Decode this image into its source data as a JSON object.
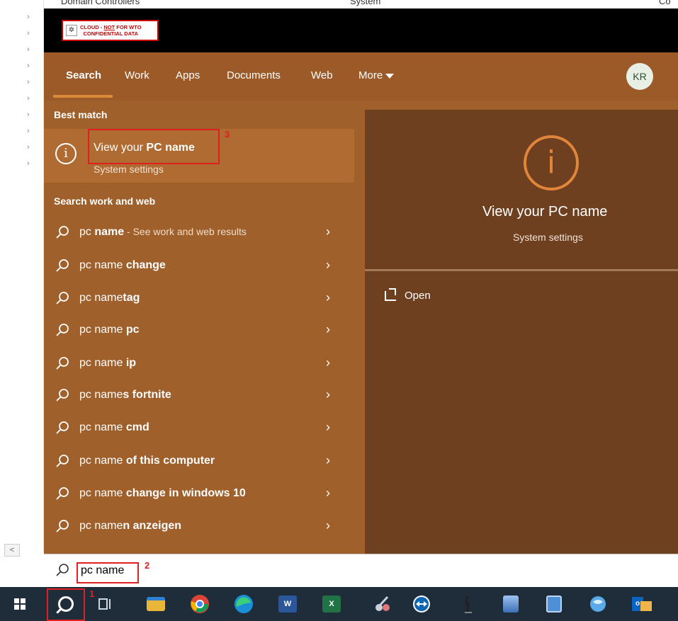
{
  "background": {
    "top_items": [
      "Domain Controllers",
      "System",
      "Co"
    ],
    "scroll_left_label": "<"
  },
  "badge": {
    "line1_prefix": "CLOUD - ",
    "line1_emph": "NOT",
    "line1_suffix": " FOR WTO",
    "line2": "CONFIDENTIAL DATA"
  },
  "tabs": [
    {
      "label": "Search",
      "active": true
    },
    {
      "label": "Work"
    },
    {
      "label": "Apps"
    },
    {
      "label": "Documents"
    },
    {
      "label": "Web"
    },
    {
      "label": "More"
    }
  ],
  "user": {
    "initials": "KR"
  },
  "best_match": {
    "section_label": "Best match",
    "title_prefix": "View your ",
    "title_bold": "PC name",
    "subtitle": "System settings",
    "annotation": "3"
  },
  "search_work_web": {
    "section_label": "Search work and web",
    "items": [
      {
        "normal": "pc ",
        "bold": "name",
        "hint": " - See work and web results"
      },
      {
        "normal": "pc name ",
        "bold": "change",
        "hint": ""
      },
      {
        "normal": "pc name",
        "bold": "tag",
        "hint": ""
      },
      {
        "normal": "pc name ",
        "bold": "pc",
        "hint": ""
      },
      {
        "normal": "pc name ",
        "bold": "ip",
        "hint": ""
      },
      {
        "normal": "pc name",
        "bold": "s fortnite",
        "hint": ""
      },
      {
        "normal": "pc name ",
        "bold": "cmd",
        "hint": ""
      },
      {
        "normal": "pc name ",
        "bold": "of this computer",
        "hint": ""
      },
      {
        "normal": "pc name ",
        "bold": "change in windows 10",
        "hint": ""
      },
      {
        "normal": "pc name",
        "bold": "n anzeigen",
        "hint": ""
      }
    ]
  },
  "preview": {
    "title": "View your PC name",
    "subtitle": "System settings",
    "open_label": "Open"
  },
  "search_box": {
    "value": "pc name",
    "annotation": "2"
  },
  "taskbar": {
    "search_annotation": "1",
    "apps": [
      "start-button",
      "search-button",
      "task-view",
      "file-explorer",
      "chrome",
      "edge",
      "word",
      "excel",
      "snipping-tool",
      "teamviewer",
      "kangaroo-app",
      "server-manager",
      "remote-app",
      "network-app",
      "outlook"
    ],
    "colors": {
      "taskbar": "#1f2c3a",
      "panel": "#a0602b",
      "accent": "#e0853a",
      "annotation": "#e02020"
    }
  }
}
